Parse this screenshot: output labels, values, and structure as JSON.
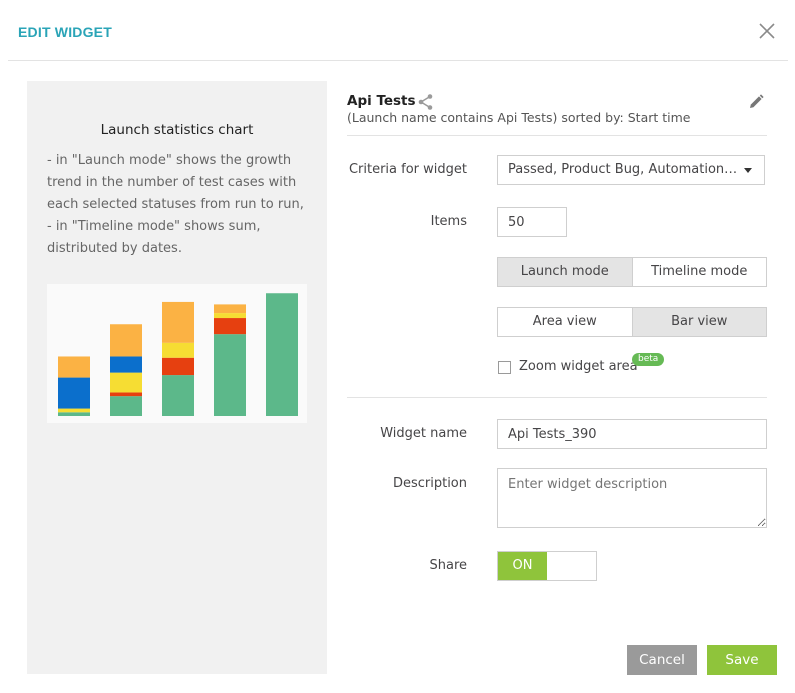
{
  "modal": {
    "title": "EDIT WIDGET"
  },
  "left_panel": {
    "title": "Launch statistics chart",
    "description": [
      "- in \"Launch mode\" shows the growth",
      "trend in the number of test cases with",
      "each selected statuses from run to run,",
      "- in \"Timeline mode\" shows sum,",
      "distributed by dates."
    ]
  },
  "widget": {
    "name": "Api Tests",
    "subtitle": "(Launch name contains Api Tests) sorted by: Start time"
  },
  "form": {
    "criteria_label": "Criteria for widget",
    "criteria_value": "Passed, Product Bug, Automation Bug, To Investigate",
    "items_label": "Items",
    "items_value": "50",
    "mode_launch": "Launch mode",
    "mode_timeline": "Timeline mode",
    "view_area": "Area view",
    "view_bar": "Bar view",
    "zoom_label": "Zoom widget area",
    "beta_label": "beta",
    "widget_name_label": "Widget name",
    "widget_name_value": "Api Tests_390",
    "description_label": "Description",
    "description_placeholder": "Enter widget description",
    "share_label": "Share",
    "share_state": "ON"
  },
  "buttons": {
    "cancel": "Cancel",
    "save": "Save"
  },
  "colors": {
    "accent": "#2aa4b7",
    "green": "#8fc43b",
    "passed": "#5cb88a",
    "product_bug": "#e64010",
    "automation_bug": "#f6dd33",
    "system_issue": "#0b6fcc",
    "to_investigate": "#fbb244"
  },
  "preview_chart": {
    "stacking_order": [
      "passed",
      "product_bug",
      "automation_bug",
      "system_issue",
      "to_investigate"
    ],
    "bars": [
      {
        "passed": 3,
        "product_bug": 0,
        "automation_bug": 3,
        "system_issue": 25,
        "to_investigate": 17
      },
      {
        "passed": 16,
        "product_bug": 3,
        "automation_bug": 16,
        "system_issue": 13,
        "to_investigate": 26
      },
      {
        "passed": 33,
        "product_bug": 14,
        "automation_bug": 12,
        "system_issue": 0,
        "to_investigate": 33
      },
      {
        "passed": 66,
        "product_bug": 13,
        "automation_bug": 4,
        "system_issue": 0,
        "to_investigate": 7
      },
      {
        "passed": 99,
        "product_bug": 0,
        "automation_bug": 0,
        "system_issue": 0,
        "to_investigate": 0
      }
    ],
    "max": 100
  }
}
